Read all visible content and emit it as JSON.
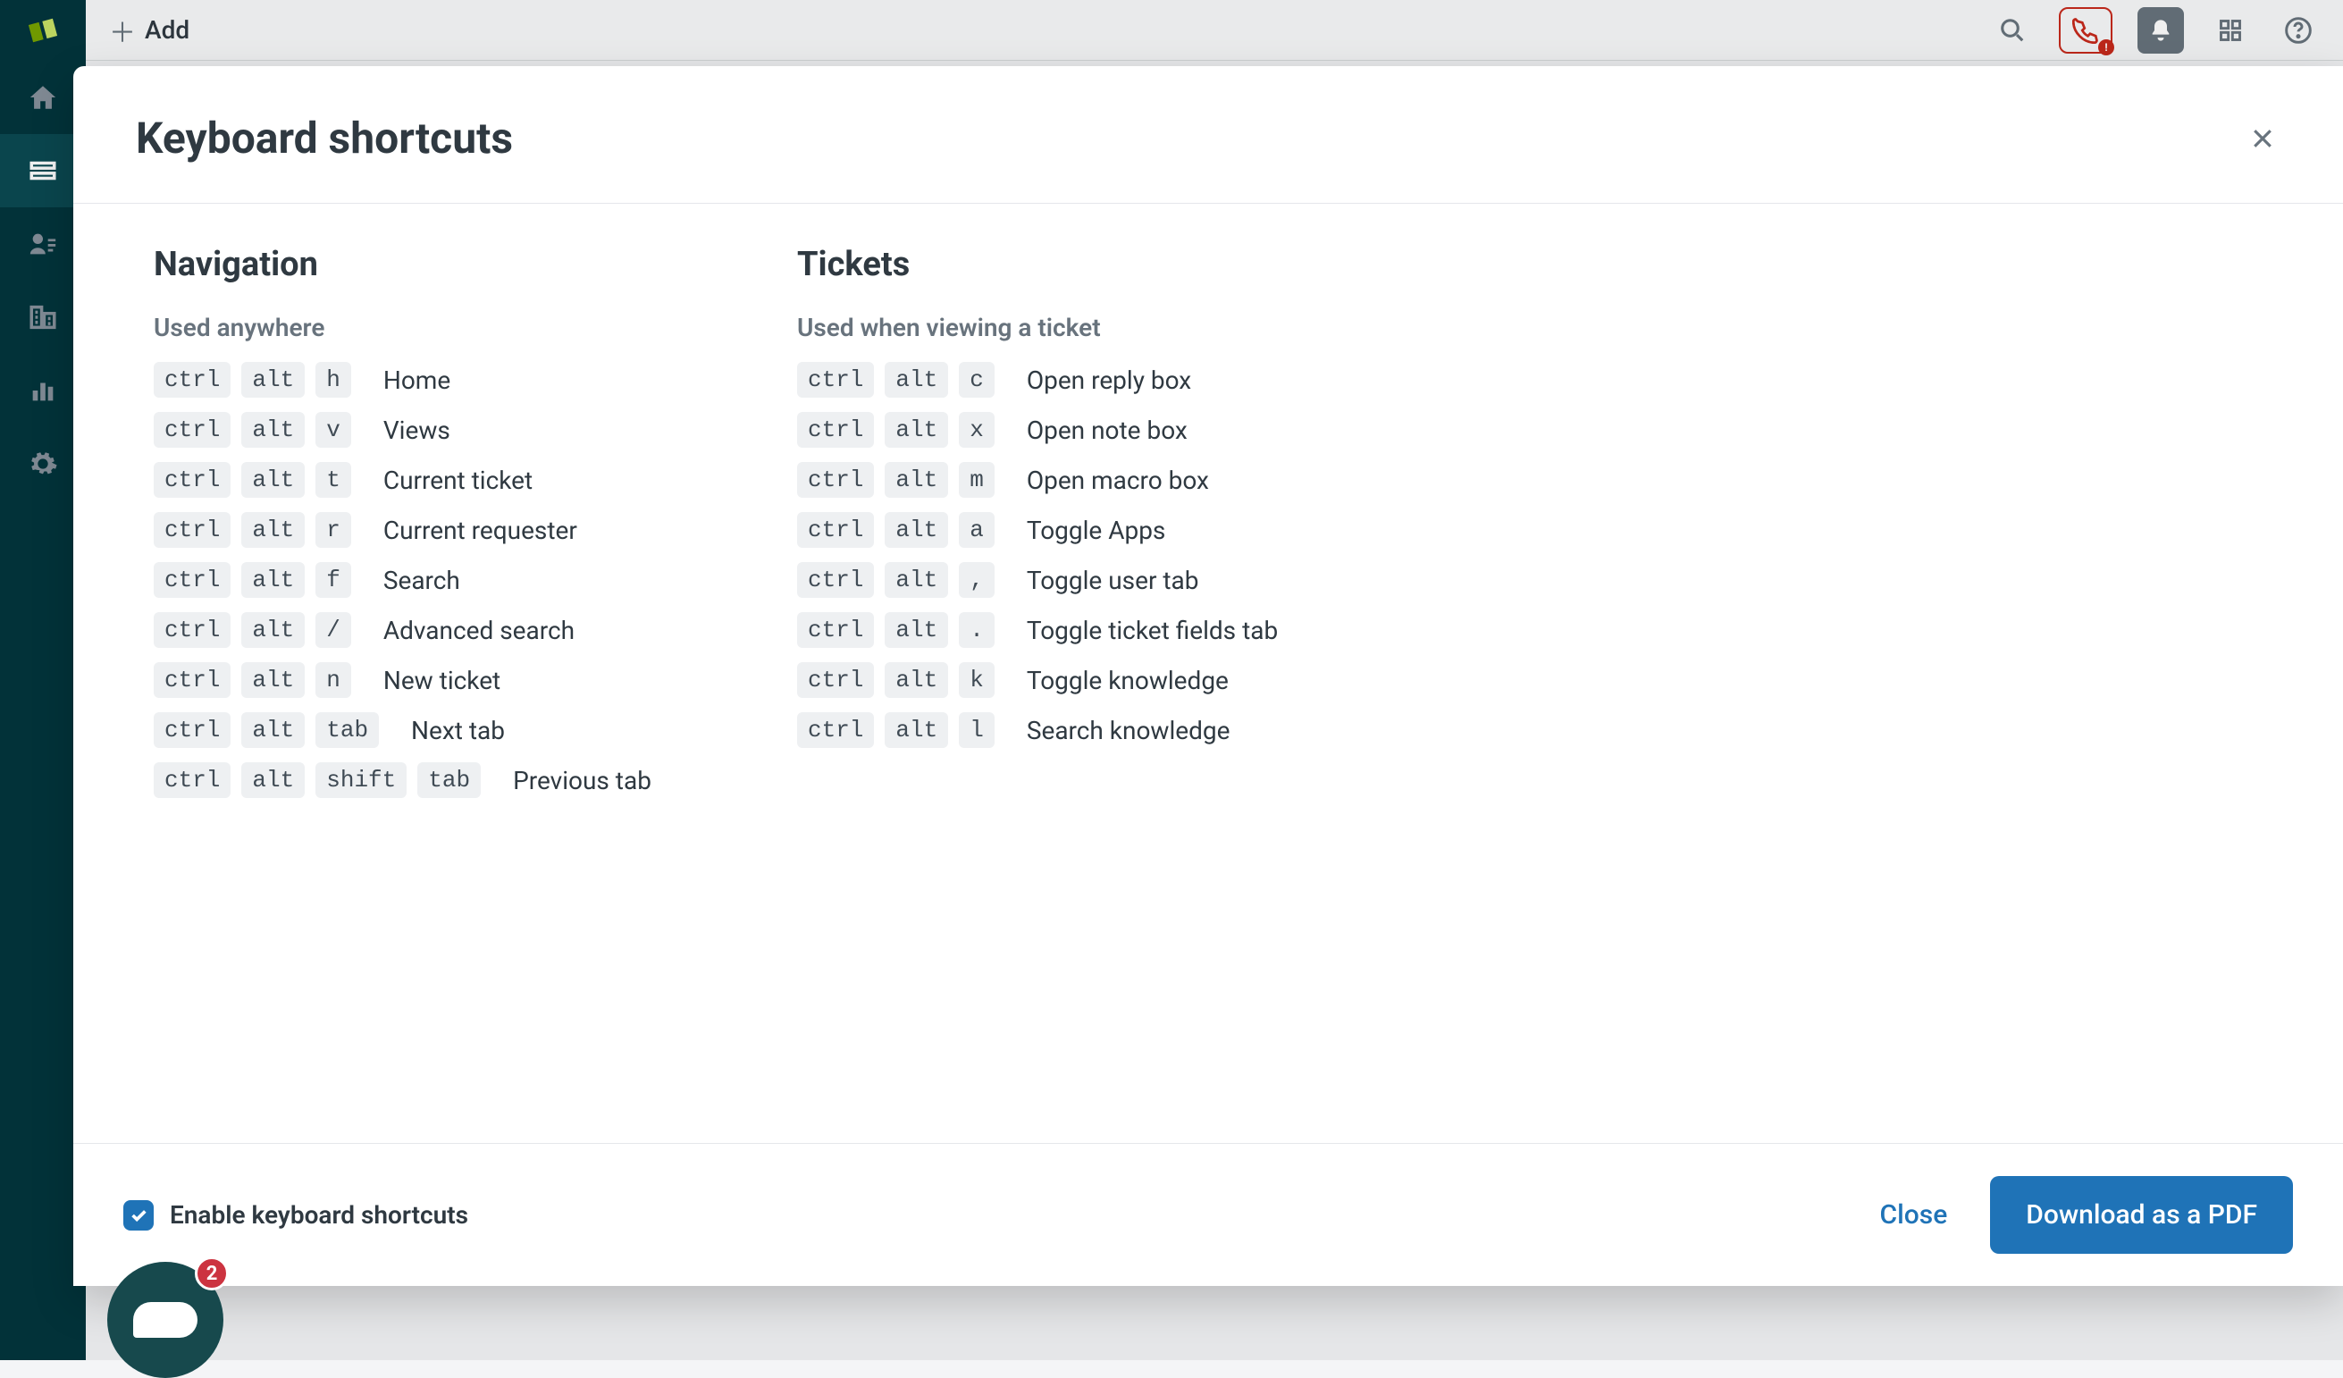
{
  "header": {
    "add_label": "Add"
  },
  "modal": {
    "title": "Keyboard shortcuts",
    "enable_label": "Enable keyboard shortcuts",
    "close_label": "Close",
    "download_label": "Download as a PDF",
    "checked": true
  },
  "chat": {
    "badge": "2"
  },
  "sections": [
    {
      "title": "Navigation",
      "subtitle": "Used anywhere",
      "shortcuts": [
        {
          "keys": [
            "ctrl",
            "alt",
            "h"
          ],
          "desc": "Home"
        },
        {
          "keys": [
            "ctrl",
            "alt",
            "v"
          ],
          "desc": "Views"
        },
        {
          "keys": [
            "ctrl",
            "alt",
            "t"
          ],
          "desc": "Current ticket"
        },
        {
          "keys": [
            "ctrl",
            "alt",
            "r"
          ],
          "desc": "Current requester"
        },
        {
          "keys": [
            "ctrl",
            "alt",
            "f"
          ],
          "desc": "Search"
        },
        {
          "keys": [
            "ctrl",
            "alt",
            "/"
          ],
          "desc": "Advanced search"
        },
        {
          "keys": [
            "ctrl",
            "alt",
            "n"
          ],
          "desc": "New ticket"
        },
        {
          "keys": [
            "ctrl",
            "alt",
            "tab"
          ],
          "desc": "Next tab"
        },
        {
          "keys": [
            "ctrl",
            "alt",
            "shift",
            "tab"
          ],
          "desc": "Previous tab"
        }
      ]
    },
    {
      "title": "Tickets",
      "subtitle": "Used when viewing a ticket",
      "shortcuts": [
        {
          "keys": [
            "ctrl",
            "alt",
            "c"
          ],
          "desc": "Open reply box"
        },
        {
          "keys": [
            "ctrl",
            "alt",
            "x"
          ],
          "desc": "Open note box"
        },
        {
          "keys": [
            "ctrl",
            "alt",
            "m"
          ],
          "desc": "Open macro box"
        },
        {
          "keys": [
            "ctrl",
            "alt",
            "a"
          ],
          "desc": "Toggle Apps"
        },
        {
          "keys": [
            "ctrl",
            "alt",
            ","
          ],
          "desc": "Toggle user tab"
        },
        {
          "keys": [
            "ctrl",
            "alt",
            "."
          ],
          "desc": "Toggle ticket fields tab"
        },
        {
          "keys": [
            "ctrl",
            "alt",
            "k"
          ],
          "desc": "Toggle knowledge"
        },
        {
          "keys": [
            "ctrl",
            "alt",
            "l"
          ],
          "desc": "Search knowledge"
        }
      ]
    }
  ]
}
